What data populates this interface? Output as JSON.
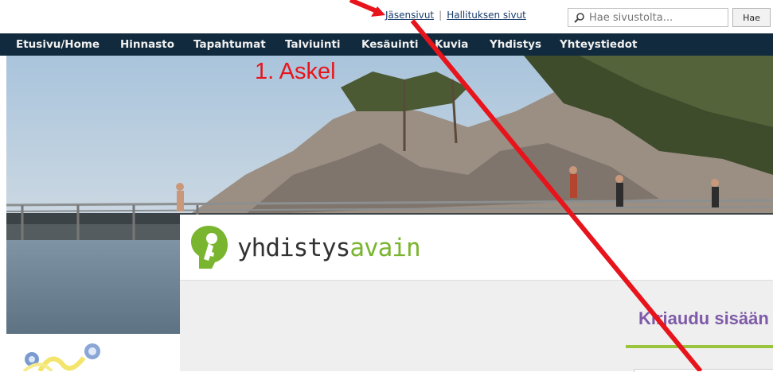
{
  "top_links": {
    "members": "Jäsensivut",
    "separator": "|",
    "board": "Hallituksen sivut"
  },
  "search": {
    "placeholder": "Hae sivustolta...",
    "button_label": "Hae",
    "icon": "search-icon"
  },
  "nav": {
    "items": [
      "Etusivu/Home",
      "Hinnasto",
      "Tapahtumat",
      "Talviuinti",
      "Kesäuinti",
      "Kuvia",
      "Yhdistys",
      "Yhteystiedot"
    ]
  },
  "annotation": {
    "text": "1. Askel",
    "color": "#e8141c"
  },
  "panel": {
    "logo_part1": "yhdistys",
    "logo_part2": "avain",
    "logo_icon": "key-icon",
    "login_title": "Kirjaudu sisään"
  },
  "colors": {
    "nav_bg": "#112a3d",
    "brand_green": "#7ab530",
    "login_purple": "#7e5aa8",
    "annotation_red": "#e8141c"
  }
}
